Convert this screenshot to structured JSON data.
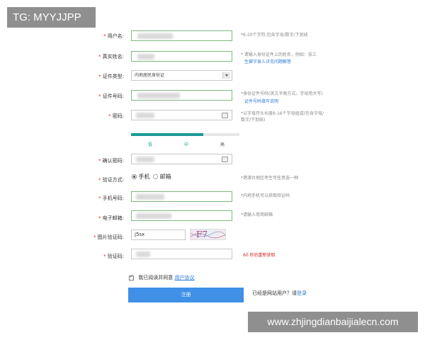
{
  "watermarks": {
    "top_left": "TG: MYYJJPP",
    "bottom_right": "www.zhjingdianbaijialecn.com"
  },
  "form": {
    "required_mark": "*",
    "username": {
      "label": "用户名:",
      "hint": "*6-20个字符,包含字母/数字/下划线"
    },
    "realname": {
      "label": "真实姓名:",
      "hint": "* 请输入身份证件上的姓名，例如：张三",
      "link": "生僻字录入详见问题解答"
    },
    "id_type": {
      "label": "证件类型:",
      "value": "内地居民身份证"
    },
    "id_number": {
      "label": "证件号码:",
      "hint": "*身份证件号码(英文半角方式，字母用大写)",
      "link": "证件号码填写说明"
    },
    "password": {
      "label": "密码:",
      "hint_line1": "*以字母开头长度6-16个字母组成(包含字母/",
      "hint_line2": "数字/下划线)"
    },
    "strength": {
      "weak": "低",
      "medium": "中",
      "strong": "高",
      "level": 2,
      "levels": 3,
      "color": "#1a9a96"
    },
    "confirm_password": {
      "label": "确认密码:"
    },
    "verify_method": {
      "label": "验证方式:",
      "option_phone": "手机",
      "option_email": "邮箱",
      "hint": "*港澳台地区考生可任意选一种"
    },
    "phone": {
      "label": "手机号码:",
      "hint": "*内地手机可以获取验证码"
    },
    "email": {
      "label": "电子邮箱:",
      "hint": "*请输入常用邮箱"
    },
    "captcha": {
      "label": "图片验证码:",
      "value": "j5sx",
      "image_text": "F7",
      "hint": ""
    },
    "code": {
      "label": "验证码:",
      "countdown": "60 秒后重新获取"
    },
    "agreement": {
      "text": "我已阅读并同意",
      "link": "用户协议"
    },
    "submit_label": "注册",
    "login_prompt": "已经是网站用户？请",
    "login_link": "登录"
  }
}
